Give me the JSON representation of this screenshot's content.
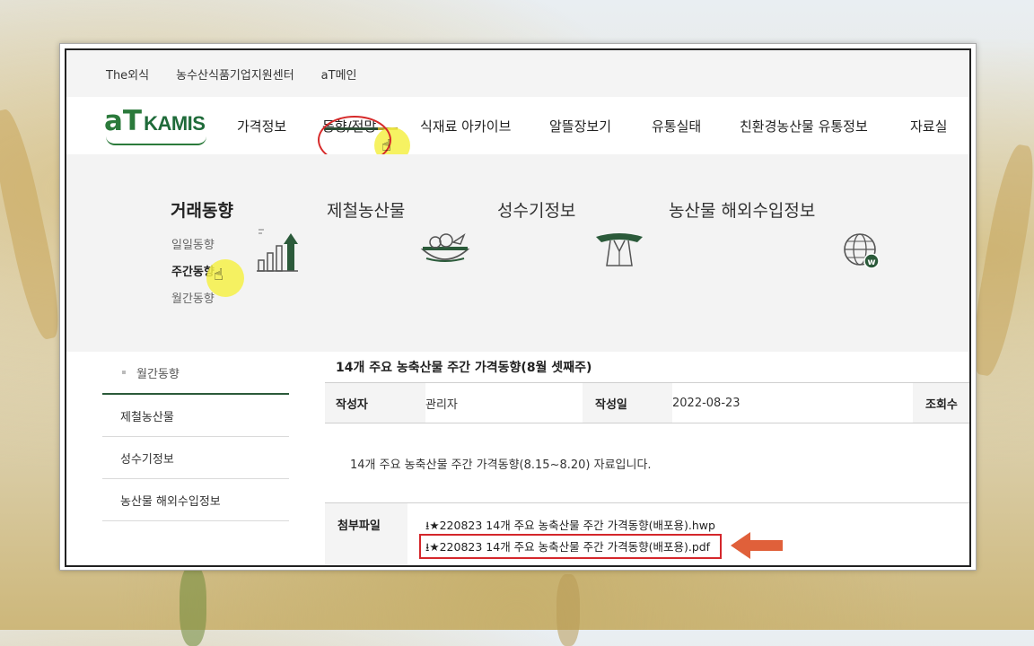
{
  "topbar": {
    "links": [
      "The외식",
      "농수산식품기업지원센터",
      "aT메인"
    ]
  },
  "logo": {
    "a": "a",
    "t": "T",
    "kamis": "KAMIS"
  },
  "nav": [
    "가격정보",
    "동향/전망",
    "식재료 아카이브",
    "알뜰장보기",
    "유통실태",
    "친환경농산물 유통정보",
    "자료실"
  ],
  "mega": {
    "col1": {
      "title": "거래동향",
      "items": [
        "일일동향",
        "주간동향",
        "월간동향"
      ]
    },
    "col2": {
      "title": "제철농산물"
    },
    "col3": {
      "title": "성수기정보"
    },
    "col4": {
      "title": "농산물 해외수입정보"
    }
  },
  "sidebar": {
    "items": [
      "월간동향",
      "제철농산물",
      "성수기정보",
      "농산물 해외수입정보"
    ]
  },
  "article": {
    "title": "14개 주요 농축산물 주간 가격동향(8월 셋째주)",
    "author_label": "작성자",
    "author": "관리자",
    "date_label": "작성일",
    "date": "2022-08-23",
    "views_label": "조회수",
    "body": "14개 주요 농축산물 주간 가격동향(8.15~8.20) 자료입니다.",
    "attach_label": "첨부파일",
    "files": [
      "★220823 14개 주요 농축산물 주간 가격동향(배포용).hwp",
      "★220823 14개 주요 농축산물 주간 가격동향(배포용).pdf"
    ]
  },
  "colors": {
    "brand_green": "#2b7a3b",
    "annotation_red": "#d4262b",
    "arrow": "#e0603a",
    "highlight": "#f5f046"
  }
}
